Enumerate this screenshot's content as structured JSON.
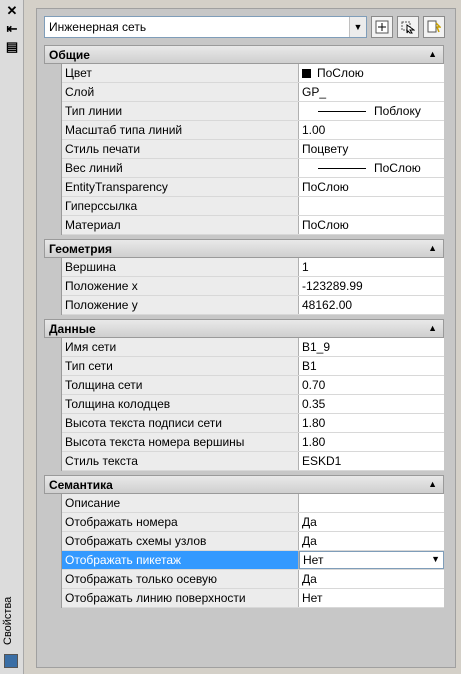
{
  "window": {
    "title": "Свойства",
    "close_glyph": "✕",
    "pin_glyph": "⇤",
    "menu_glyph": "▤"
  },
  "toolbar": {
    "selector_value": "Инженерная сеть"
  },
  "categories": [
    {
      "label": "Общие",
      "rows": [
        {
          "name": "Цвет",
          "value": "ПоСлою"
        },
        {
          "name": "Слой",
          "value": "GP_"
        },
        {
          "name": "Тип линии",
          "value": "Поблоку"
        },
        {
          "name": "Масштаб типа линий",
          "value": "1.00"
        },
        {
          "name": "Стиль печати",
          "value": "Поцвету"
        },
        {
          "name": "Вес линий",
          "value": "ПоСлою"
        },
        {
          "name": "EntityTransparency",
          "value": "ПоСлою"
        },
        {
          "name": "Гиперссылка",
          "value": ""
        },
        {
          "name": "Материал",
          "value": "ПоСлою"
        }
      ]
    },
    {
      "label": "Геометрия",
      "rows": [
        {
          "name": "Вершина",
          "value": "1"
        },
        {
          "name": "Положение x",
          "value": "-123289.99"
        },
        {
          "name": "Положение y",
          "value": "48162.00"
        }
      ]
    },
    {
      "label": "Данные",
      "rows": [
        {
          "name": "Имя сети",
          "value": "B1_9"
        },
        {
          "name": "Тип сети",
          "value": "B1"
        },
        {
          "name": "Толщина сети",
          "value": "0.70"
        },
        {
          "name": "Толщина колодцев",
          "value": "0.35"
        },
        {
          "name": "Высота текста подписи сети",
          "value": "1.80"
        },
        {
          "name": "Высота текста номера вершины",
          "value": "1.80"
        },
        {
          "name": "Стиль текста",
          "value": "ESKD1"
        }
      ]
    },
    {
      "label": "Семантика",
      "rows": [
        {
          "name": "Описание",
          "value": ""
        },
        {
          "name": "Отображать номера",
          "value": "Да"
        },
        {
          "name": "Отображать схемы узлов",
          "value": "Да"
        },
        {
          "name": "Отображать пикетаж",
          "value": "Нет"
        },
        {
          "name": "Отображать только осевую",
          "value": "Да"
        },
        {
          "name": "Отображать линию поверхности",
          "value": "Нет"
        }
      ]
    }
  ],
  "colors": {
    "selection": "#3399ff",
    "category_bg": "#d9d9d9"
  }
}
